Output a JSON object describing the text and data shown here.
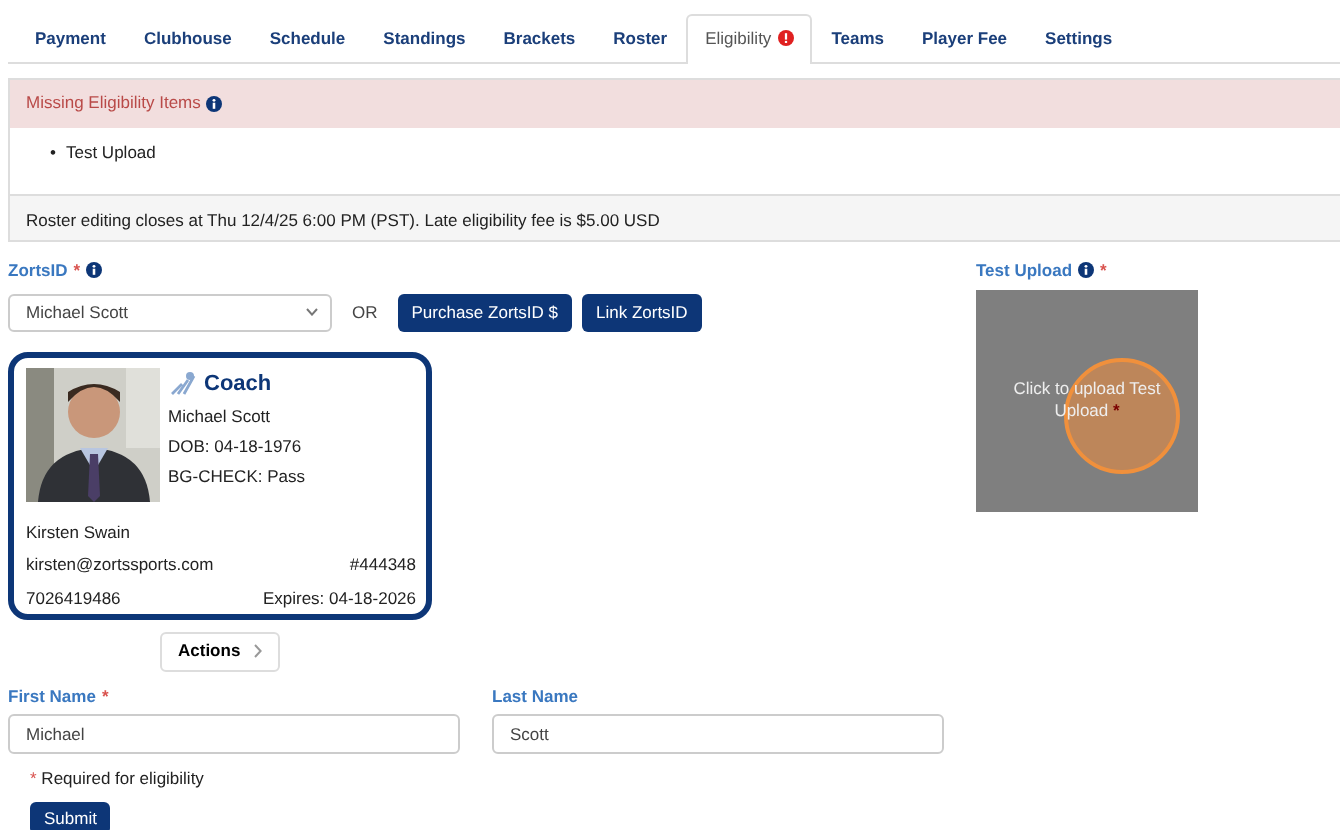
{
  "tabs": [
    {
      "label": "Payment",
      "selected": false,
      "alert": false
    },
    {
      "label": "Clubhouse",
      "selected": false,
      "alert": false
    },
    {
      "label": "Schedule",
      "selected": false,
      "alert": false
    },
    {
      "label": "Standings",
      "selected": false,
      "alert": false
    },
    {
      "label": "Brackets",
      "selected": false,
      "alert": false
    },
    {
      "label": "Roster",
      "selected": false,
      "alert": false
    },
    {
      "label": "Eligibility",
      "selected": true,
      "alert": true
    },
    {
      "label": "Teams",
      "selected": false,
      "alert": false
    },
    {
      "label": "Player Fee",
      "selected": false,
      "alert": false
    },
    {
      "label": "Settings",
      "selected": false,
      "alert": false
    }
  ],
  "missing": {
    "title": "Missing Eligibility Items",
    "bullet": "•",
    "items": [
      "Test Upload"
    ],
    "note": "Roster editing closes at Thu 12/4/25 6:00 PM (PST). Late eligibility fee is $5.00 USD"
  },
  "zortsid": {
    "label": "ZortsID",
    "required_mark": "*",
    "select_value": "Michael Scott",
    "or": "OR",
    "buttons": [
      "Purchase ZortsID $",
      "Link ZortsID"
    ]
  },
  "card": {
    "role": "Coach",
    "lines": [
      "Michael Scott",
      "DOB: 04-18-1976",
      "BG-CHECK: Pass"
    ],
    "contact": "Kirsten Swain",
    "email": "kirsten@zortssports.com",
    "number": "#444348",
    "phone": "7026419486",
    "expires": "Expires: 04-18-2026"
  },
  "actions_button": "Actions",
  "upload": {
    "label": "Test Upload",
    "required_mark": "*",
    "prompt": "Click to upload Test Upload",
    "prompt_mark": "*"
  },
  "fields": [
    {
      "label": "First Name",
      "required_mark": "*",
      "value": "Michael"
    },
    {
      "label": "Last Name",
      "value": "Scott"
    }
  ],
  "required_note": {
    "mark": "*",
    "text": "Required for eligibility"
  },
  "submit": "Submit"
}
